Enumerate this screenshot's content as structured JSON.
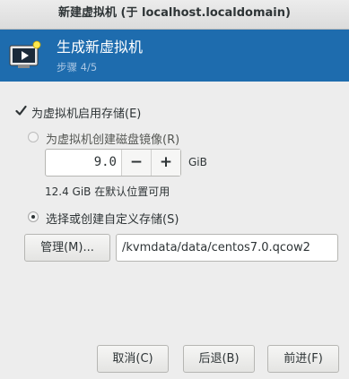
{
  "window": {
    "title": "新建虚拟机 (于 localhost.localdomain)"
  },
  "banner": {
    "title": "生成新虚拟机",
    "step": "步骤 4/5",
    "icon": "monitor-play-icon"
  },
  "storage": {
    "enable_label": "为虚拟机启用存储(E)",
    "enable_checked": true,
    "create_image_label": "为虚拟机创建磁盘镜像(R)",
    "create_image_selected": false,
    "size_value": "9.0",
    "minus_label": "−",
    "plus_label": "+",
    "size_unit": "GiB",
    "available_text": "12.4 GiB 在默认位置可用",
    "custom_label": "选择或创建自定义存储(S)",
    "custom_selected": true,
    "manage_label": "管理(M)...",
    "path_value": "/kvmdata/data/centos7.0.qcow2"
  },
  "footer": {
    "cancel_label": "取消(C)",
    "back_label": "后退(B)",
    "forward_label": "前进(F)"
  }
}
